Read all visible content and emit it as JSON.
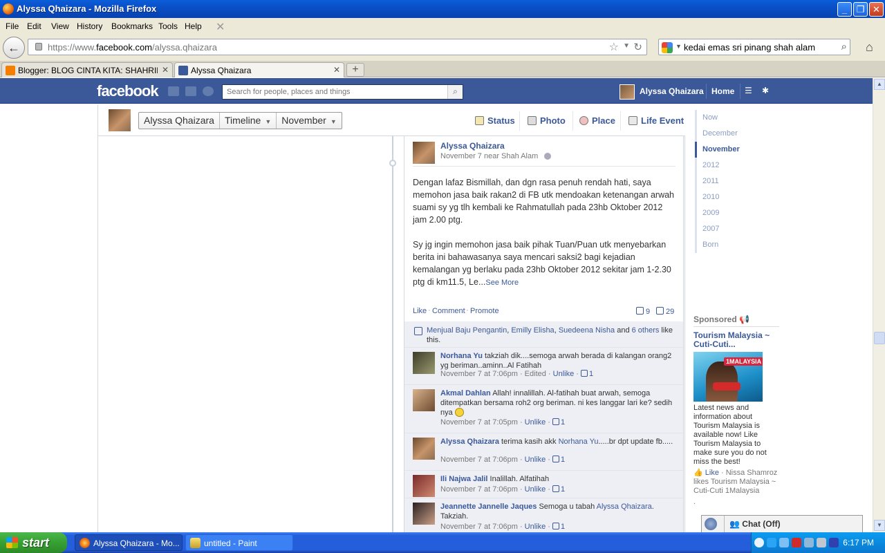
{
  "window": {
    "title": "Alyssa Qhaizara - Mozilla Firefox",
    "controls": {
      "minimize": "_",
      "maximize": "❐",
      "close": "✕"
    }
  },
  "menu": [
    "File",
    "Edit",
    "View",
    "History",
    "Bookmarks",
    "Tools",
    "Help"
  ],
  "nav": {
    "url_prefix": "https://www.",
    "url_domain": "facebook.com",
    "url_path": "/alyssa.qhaizara",
    "search_value": "kedai emas sri pinang shah alam"
  },
  "tabs": [
    {
      "label": "Blogger: BLOG CINTA KITA: SHAHRILYSS...",
      "active": false
    },
    {
      "label": "Alyssa Qhaizara",
      "active": true
    }
  ],
  "fb": {
    "logo": "facebook",
    "search_placeholder": "Search for people, places and things",
    "user_name": "Alyssa Qhaizara",
    "home": "Home"
  },
  "timeline_header": {
    "name": "Alyssa Qhaizara",
    "view": "Timeline",
    "month": "November",
    "composer": [
      "Status",
      "Photo",
      "Place",
      "Life Event"
    ]
  },
  "post": {
    "author": "Alyssa Qhaizara",
    "meta": "November 7 near Shah Alam",
    "para1": "Dengan lafaz Bismillah, dan dgn rasa penuh rendah hati, saya memohon jasa baik rakan2 di FB utk mendoakan ketenangan arwah suami sy yg tlh kembali ke Rahmatullah pada 23hb Oktober 2012 jam 2.00 ptg.",
    "para2": "Sy jg ingin memohon jasa baik pihak Tuan/Puan utk menyebarkan berita ini bahawasanya saya mencari saksi2 bagi kejadian kemalangan yg berlaku pada 23hb Oktober 2012 sekitar jam 1-2.30 ptg di km11.5, Le...",
    "see_more": "See More",
    "actions": [
      "Like",
      "Comment",
      "Promote"
    ],
    "like_count": "9",
    "comment_count": "29",
    "likers": {
      "names": [
        "Menjual Baju Pengantin",
        "Emilly Elisha",
        "Suedeena Nisha"
      ],
      "and": " and ",
      "others": "6 others",
      "tail": " like this."
    }
  },
  "comments": [
    {
      "name": "Norhana Yu",
      "text": " takziah dik....semoga arwah berada di kalangan orang2 yg beriman..aminn..Al Fatihah",
      "time": "November 7 at 7:06pm",
      "edited": " · Edited",
      "action": "Unlike",
      "likes": "1"
    },
    {
      "name": "Akmal Dahlan",
      "text": " Allah! innalillah. Al-fatihah buat arwah, semoga ditempatkan bersama roh2 org beriman. ni kes langgar lari ke? sedih nya ",
      "time": "November 7 at 7:05pm",
      "action": "Unlike",
      "likes": "1"
    },
    {
      "name": "Alyssa Qhaizara",
      "text_pre": " terima kasih akk ",
      "mention": "Norhana Yu",
      "text_post": ".....br dpt update fb.....",
      "time": "November 7 at 7:06pm",
      "action": "Unlike",
      "likes": "1"
    },
    {
      "name": "Ili Najwa Jalil",
      "text": " Inalillah. Alfatihah",
      "time": "November 7 at 7:06pm",
      "action": "Unlike",
      "likes": "1"
    },
    {
      "name": "Jeannette Jannelle Jaques",
      "text_pre": " Semoga u tabah ",
      "mention": "Alyssa Qhaizara",
      "text_post": ". Takziah.",
      "time": "November 7 at 7:06pm",
      "action": "Unlike",
      "likes": "1"
    }
  ],
  "scrubber": [
    "Now",
    "December",
    "November",
    "2012",
    "2011",
    "2010",
    "2009",
    "2007",
    "Born"
  ],
  "sponsored": {
    "heading": "Sponsored",
    "title": "Tourism Malaysia ~ Cuti-Cuti...",
    "img_tag": "1MALAYSIA",
    "body": "Latest news and information about Tourism Malaysia is available now! Like Tourism Malaysia to make sure you do not miss the best!",
    "like": "Like",
    "liker": " · Nissa Shamroz likes Tourism Malaysia ~ Cuti-Cuti 1Malaysia",
    "trail": "."
  },
  "chat": "Chat (Off)",
  "taskbar": {
    "start": "start",
    "items": [
      "Alyssa Qhaizara - Mo...",
      "untitled - Paint"
    ],
    "clock": "6:17 PM"
  },
  "colors": {
    "fb_blue": "#3b5998",
    "xp_blue": "#245edb",
    "start_green": "#36a032"
  }
}
